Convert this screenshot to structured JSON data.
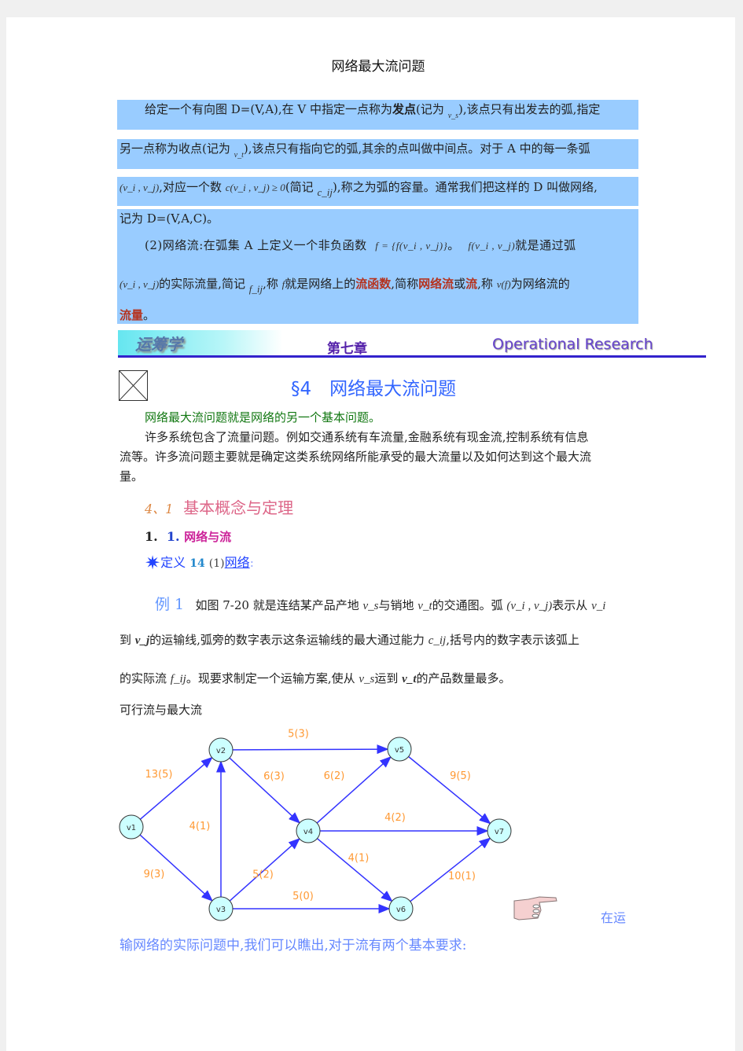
{
  "doc_title": "网络最大流问题",
  "definition_box": {
    "line1": {
      "a": "给定一个有向图 D=(V,A),在 V 中指定一点称为",
      "bold": "发点",
      "b": "(记为",
      "math": "v_s",
      "c": "),该点只有出发去的弧,指定"
    },
    "line2": {
      "a": "另一点称为收点(记为",
      "math": "v_t",
      "b": "),该点只有指向它的弧,其余的点叫做中间点。对于 A 中的每一条弧"
    },
    "line3": {
      "m1": "(v_i , v_j)",
      "a": ",对应一个数",
      "m2": "c(v_i , v_j) ≥ 0",
      "b": "(简记",
      "m3": "c_ij",
      "c": "),称之为弧的容量。通常我们把这样的 D 叫做网络,"
    },
    "line4": "记为 D=(V,A,C)。",
    "line5": {
      "a": "(2)网络流:在弧集 A 上定义一个非负函数",
      "m1": "f = {f(v_i , v_j)}",
      "b": "。",
      "m2": "f(v_i , v_j)",
      "c": "就是通过弧"
    },
    "line6": {
      "m1": "(v_i , v_j)",
      "a": "的实际流量,简记",
      "m2": "f_ij",
      "b": ",称",
      "m3": "f",
      "c": "就是网络上的",
      "r1": "流函数",
      "d": ",简称",
      "r2": "网络流",
      "e": "或",
      "r3": "流",
      "f": ",称",
      "m4": "v(f)",
      "g": "为网络流的"
    },
    "line7": {
      "r": "流量",
      "a": "。"
    }
  },
  "banner": {
    "logo": "运筹学",
    "chapter": "第七章",
    "subject": "Operational Research"
  },
  "section": {
    "title": "§4　网络最大流问题",
    "image_placeholder": "broken-image-icon"
  },
  "intro": "网络最大流问题就是网络的另一个基本问题。",
  "para": [
    "许多系统包含了流量问题。例如交通系统有车流量,金融系统有现金流,控制系统有信息",
    "流等。许多流问题主要就是确定这类系统网络所能承受的最大流量以及如何达到这个最大流",
    "量。"
  ],
  "subsection": {
    "num": "4、1",
    "title": "基本概念与定理"
  },
  "subsub": {
    "num1": "1.",
    "num2": "1.",
    "title": "网络与流"
  },
  "definition": {
    "label": "定义",
    "num": "14",
    "paren": "(1)",
    "link": "网络",
    "colon": ":"
  },
  "example": {
    "label": "例 1",
    "l1": {
      "a": "如图 7-20 就是连结某产品产地",
      "m1": "v_s",
      "b": "与销地",
      "m2": "v_t",
      "c": "的交通图。弧",
      "m3": "(v_i , v_j)",
      "d": "表示从",
      "m4": "v_i"
    },
    "l2": {
      "a": "到",
      "m1": "v_j",
      "b": "的运输线,弧旁的数字表示这条运输线的最大通过能力",
      "m2": "c_ij",
      "c": ",括号内的数字表示该弧上"
    },
    "l3": {
      "a": "的实际流",
      "m1": "f_ij",
      "b": "。现要求制定一个运输方案,使从",
      "m2": "v_s",
      "c": "运到",
      "m3": "v_t",
      "d": "的产品数量最多。"
    }
  },
  "feasible_heading": "可行流与最大流",
  "graph": {
    "nodes": [
      {
        "id": "v1",
        "label": "v1"
      },
      {
        "id": "v2",
        "label": "v2"
      },
      {
        "id": "v3",
        "label": "v3"
      },
      {
        "id": "v4",
        "label": "v4"
      },
      {
        "id": "v5",
        "label": "v5"
      },
      {
        "id": "v6",
        "label": "v6"
      },
      {
        "id": "v7",
        "label": "v7"
      }
    ],
    "edges": [
      {
        "from": "v1",
        "to": "v2",
        "label": "13(5)"
      },
      {
        "from": "v1",
        "to": "v3",
        "label": "9(3)"
      },
      {
        "from": "v3",
        "to": "v2",
        "label": "4(1)"
      },
      {
        "from": "v2",
        "to": "v5",
        "label": "5(3)"
      },
      {
        "from": "v2",
        "to": "v4",
        "label": "6(3)"
      },
      {
        "from": "v3",
        "to": "v4",
        "label": "5(2)"
      },
      {
        "from": "v3",
        "to": "v6",
        "label": "5(0)"
      },
      {
        "from": "v4",
        "to": "v5",
        "label": "6(2)"
      },
      {
        "from": "v4",
        "to": "v7",
        "label": "4(2)"
      },
      {
        "from": "v4",
        "to": "v6",
        "label": "4(1)"
      },
      {
        "from": "v5",
        "to": "v7",
        "label": "9(5)"
      },
      {
        "from": "v6",
        "to": "v7",
        "label": "10(1)"
      }
    ],
    "colors": {
      "node_fill": "#ccffff",
      "edge": "#3333ff",
      "label": "#ff9933"
    }
  },
  "pointer_icon": "pointing-hand-icon",
  "closing": {
    "a": "在运",
    "b": "输网络的实际问题中,我们可以瞧出,对于流有两个基本要求:"
  }
}
